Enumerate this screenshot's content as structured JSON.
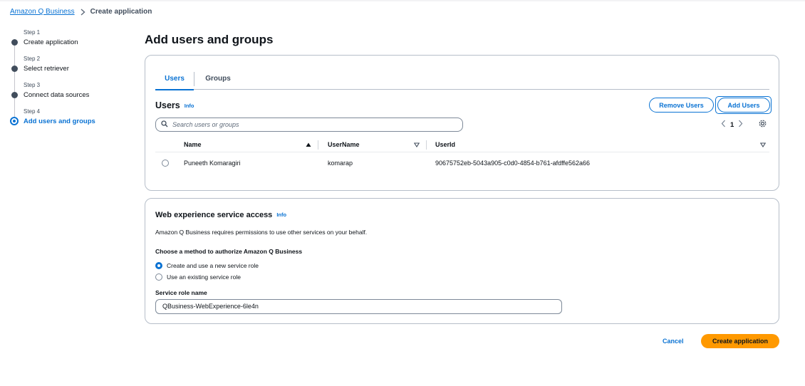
{
  "breadcrumb": {
    "root": "Amazon Q Business",
    "current": "Create application"
  },
  "steps": [
    {
      "num": "Step 1",
      "label": "Create application"
    },
    {
      "num": "Step 2",
      "label": "Select retriever"
    },
    {
      "num": "Step 3",
      "label": "Connect data sources"
    },
    {
      "num": "Step 4",
      "label": "Add users and groups",
      "active": true
    }
  ],
  "page": {
    "title": "Add users and groups"
  },
  "users_panel": {
    "tabs": [
      "Users",
      "Groups"
    ],
    "heading": "Users",
    "info": "Info",
    "remove_button": "Remove Users",
    "add_button": "Add Users",
    "search_placeholder": "Search users or groups",
    "page_number": "1",
    "columns": [
      "Name",
      "UserName",
      "UserId"
    ],
    "rows": [
      {
        "name": "Puneeth Komaragiri",
        "username": "komarap",
        "userid": "90675752eb-5043a905-c0d0-4854-b761-afdffe562a66"
      }
    ]
  },
  "service_panel": {
    "title": "Web experience service access",
    "info": "Info",
    "description": "Amazon Q Business requires permissions to use other services on your behalf.",
    "method_label": "Choose a method to authorize Amazon Q Business",
    "options": [
      "Create and use a new service role",
      "Use an existing service role"
    ],
    "selected_option": "Create and use a new service role",
    "role_name_label": "Service role name",
    "role_name_value": "QBusiness-WebExperience-6le4n"
  },
  "footer": {
    "cancel": "Cancel",
    "create": "Create application"
  },
  "colors": {
    "accent": "#0972d3",
    "primary_button": "#ff9900"
  }
}
